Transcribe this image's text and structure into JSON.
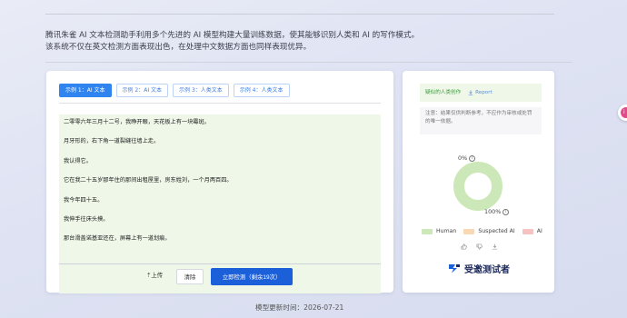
{
  "intro": {
    "line1": "腾讯朱雀 AI 文本检测助手利用多个先进的 AI 模型构建大量训练数据，使其能够识别人类和 AI 的写作模式。",
    "line2": "该系统不仅在英文检测方面表现出色，在处理中文数据方面也同样表现优异。"
  },
  "tabs": [
    {
      "label": "示例 1：AI 文本",
      "active": true
    },
    {
      "label": "示例 2：AI 文本",
      "active": false
    },
    {
      "label": "示例 3：人类文本",
      "active": false
    },
    {
      "label": "示例 4：人类文本",
      "active": false
    }
  ],
  "sample_text": [
    "二零零六年三月十二号，我睁开眼，天花板上有一块霉斑。",
    "月牙形的，右下角一道裂缝往墙上走。",
    "我认得它。",
    "它在我二十五岁那年住的那间出租屋里，房东姓刘，一个月两百四。",
    "我今年四十五。",
    "我伸手往床头摸。",
    "那台滑盖诺基亚还在，屏幕上有一道划痕。"
  ],
  "actions": {
    "upload": "⇡上传",
    "clear": "清除",
    "detect": "立即检测（剩余19次）"
  },
  "result": {
    "verdict": "疑似的人类创作",
    "report": "Report",
    "notice": "注意：结果仅供判断参考，不应作为审核或处罚的唯一依据。",
    "top_pct": "0%",
    "bottom_pct": "100%",
    "human_pct": 100,
    "legend": [
      "Human",
      "Suspected AI",
      "AI"
    ],
    "colors": {
      "human": "#cde8b8",
      "suspected": "#f8d9b4",
      "ai": "#f6c3c3"
    }
  },
  "brand": {
    "name": "受邀测试者"
  },
  "footer": "模型更新时间：2026-07-21",
  "side_bubble": "i"
}
